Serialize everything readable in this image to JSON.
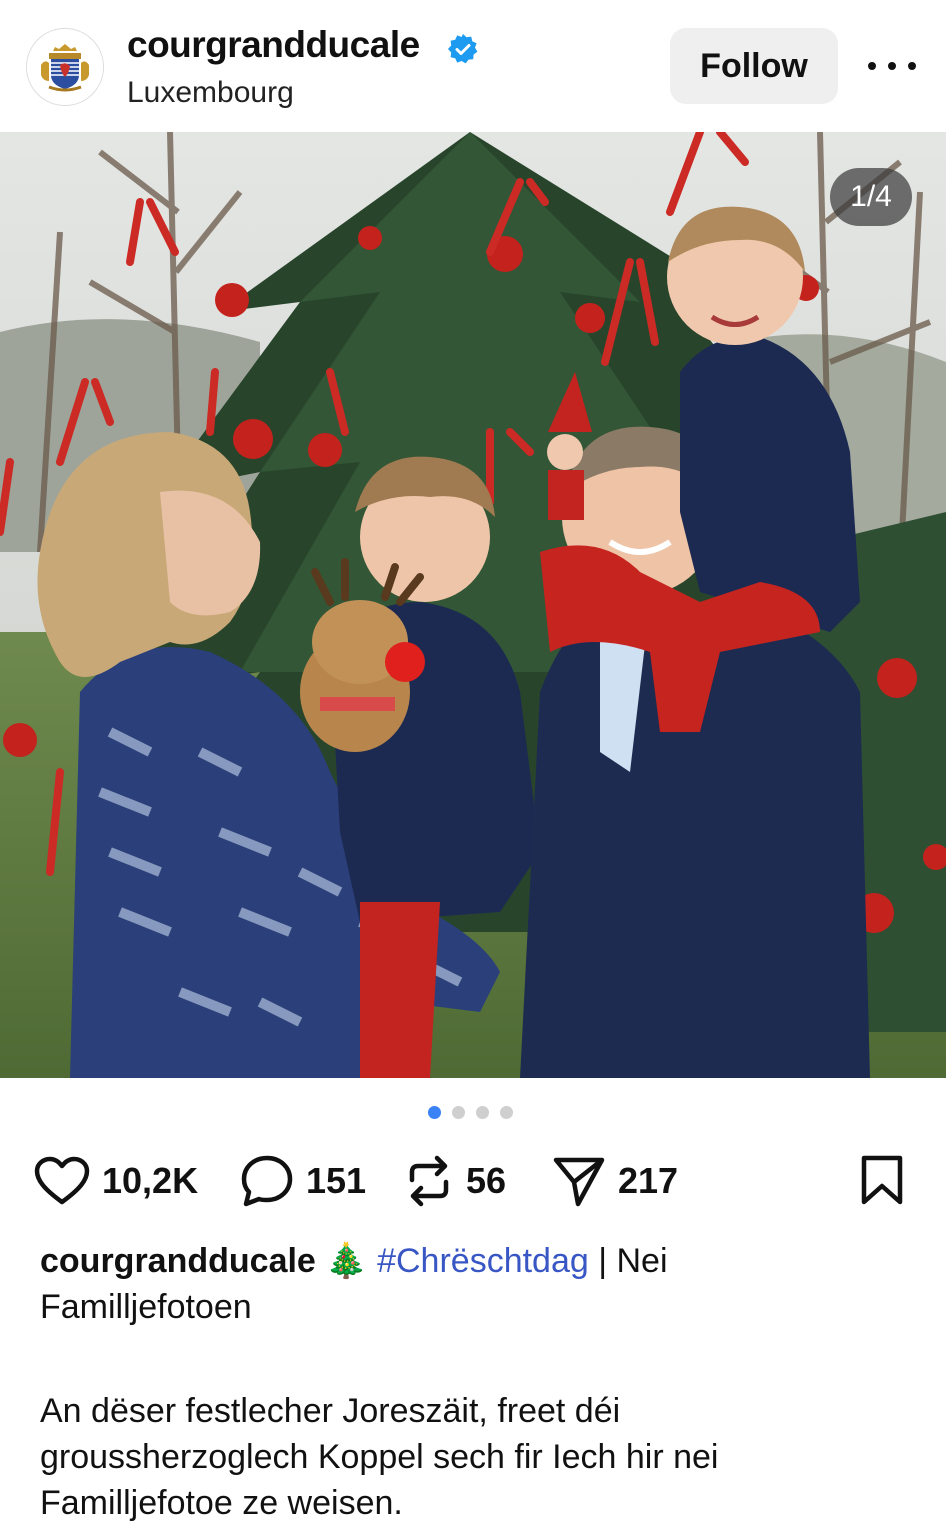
{
  "header": {
    "username": "courgrandducale",
    "location": "Luxembourg",
    "follow_label": "Follow"
  },
  "post": {
    "slide_counter": "1/4",
    "slide_count": 4,
    "active_slide": 1
  },
  "actions": {
    "likes": "10,2K",
    "comments": "151",
    "reposts": "56",
    "shares": "217"
  },
  "caption": {
    "username": "courgrandducale",
    "emoji": "🎄",
    "hashtag": "#Chrëschtdag",
    "separator": " | Nei",
    "line2": "Familljefotoen"
  },
  "description": {
    "line1": "An dëser festlecher Joreszäit, freet déi",
    "line2": "groussherzoglech Koppel sech fir Iech hir nei",
    "line3": "Familljefotoe ze weisen."
  },
  "colors": {
    "accent": "#3b82f6",
    "hashtag": "#3856c4",
    "verified": "#1d9bf0",
    "follow_bg": "#efefef"
  }
}
